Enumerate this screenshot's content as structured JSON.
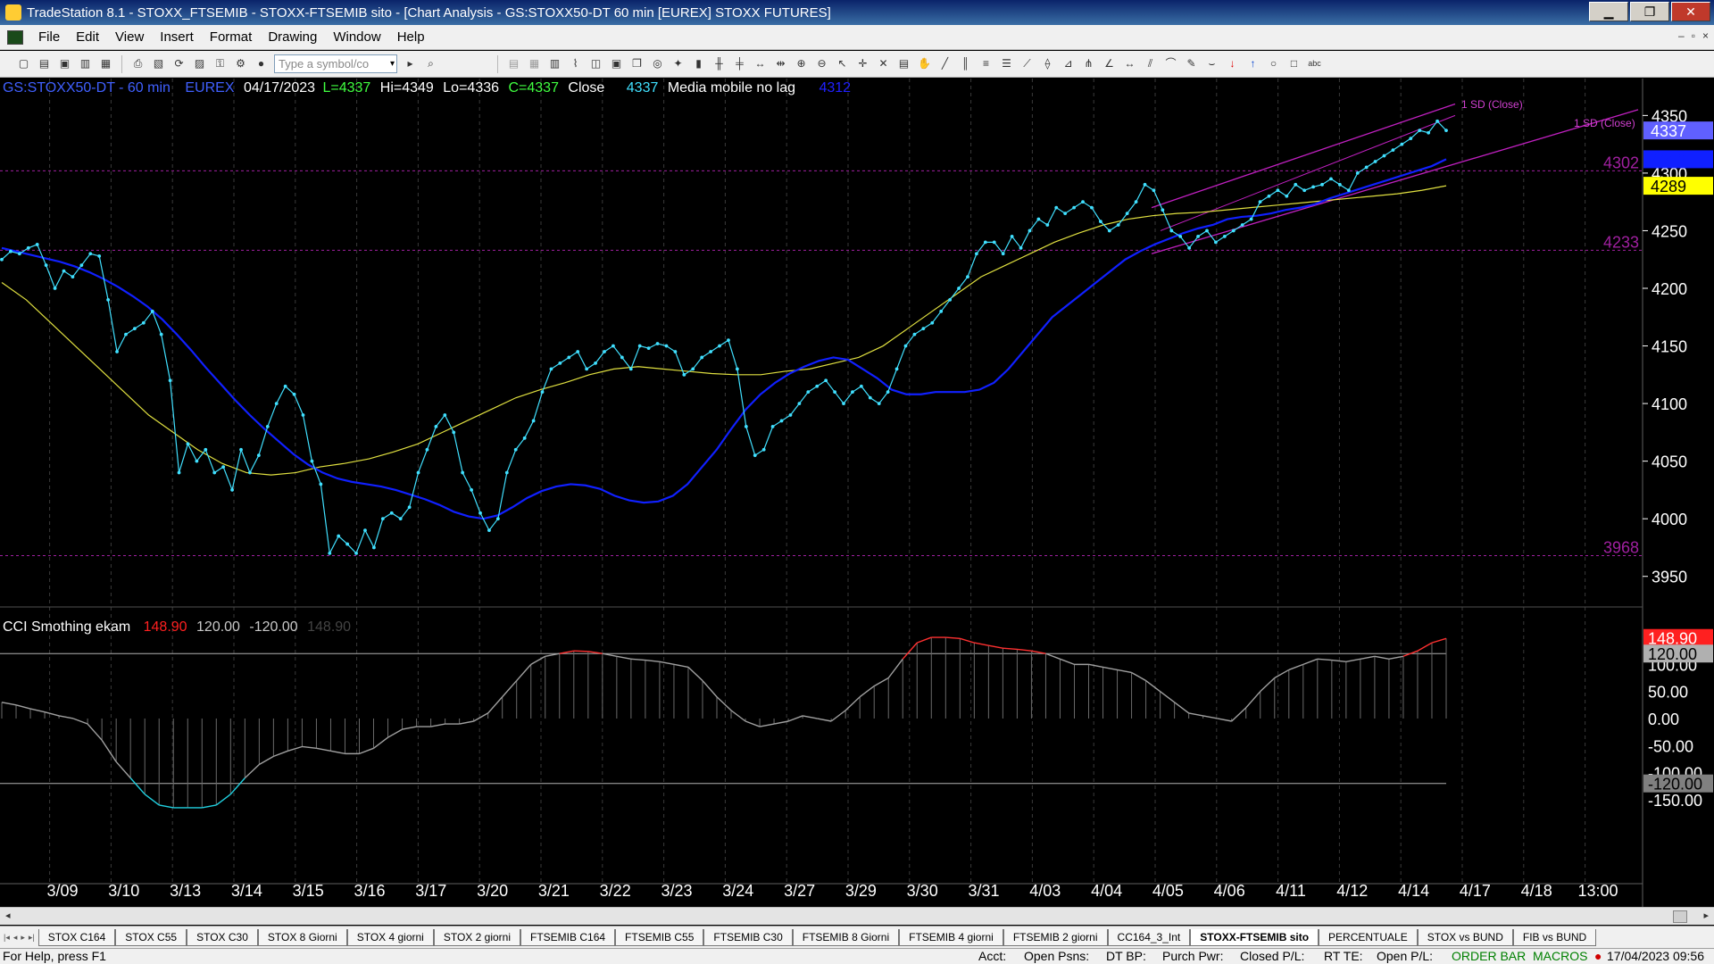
{
  "window": {
    "title": "TradeStation 8.1 - STOXX_FTSEMIB - STOXX-FTSEMIB sito - [Chart Analysis - GS:STOXX50-DT  60 min  [EUREX] STOXX FUTURES]",
    "btn_minimize": "▁",
    "btn_restore": "❐",
    "btn_close": "✕"
  },
  "menu": [
    "File",
    "Edit",
    "View",
    "Insert",
    "Format",
    "Drawing",
    "Window",
    "Help"
  ],
  "mdi_buttons": [
    "–",
    "▫",
    "×"
  ],
  "toolbar": {
    "symbol_placeholder": "Type a symbol/co",
    "dropdown_arrow": "▾"
  },
  "toolbar_icons_left": [
    "new-doc",
    "open",
    "save",
    "print",
    "print-preview",
    "refresh",
    "clipboard",
    "lock",
    "settings",
    "ticker"
  ],
  "toolbar_icons_right": [
    "bars",
    "chart-type",
    "grid",
    "zoom-in",
    "zoom-out",
    "cursor",
    "crosshair",
    "tools",
    "trendline",
    "channel",
    "fib",
    "ellipse",
    "text"
  ],
  "header": {
    "symbol": "GS:STOXX50-DT - 60 min",
    "exchange": "EUREX",
    "date": "04/17/2023",
    "last": "L=4337",
    "high": "Hi=4349",
    "low": "Lo=4336",
    "close": "C=4337",
    "close_label": "Close",
    "close_value": "4337",
    "indicator_name": "Media mobile no lag",
    "indicator_value": "4312",
    "color_symbol": "#4060ff",
    "color_ohlc": "#ffffff",
    "color_close": "#40ff40",
    "color_close_value": "#40e0ff",
    "color_indicator_value": "#2020ff"
  },
  "price_axis": {
    "ticks": [
      "4350",
      "4300",
      "4250",
      "4200",
      "4150",
      "4100",
      "4050",
      "4000",
      "3950"
    ],
    "tag_close": "4337",
    "tag_ma": "4312",
    "tag_ma2": "4289",
    "level_labels": [
      "4302",
      "4233",
      "3968"
    ],
    "channel_label_1": "1 SD (Close)",
    "channel_label_2": "1 SD (Close)"
  },
  "cci_header": {
    "name": "CCI Smothing ekam",
    "value": "148.90",
    "upper": "120.00",
    "lower": "-120.00",
    "ghost": "148.90"
  },
  "cci_axis": {
    "ticks": [
      "100.00",
      "50.00",
      "0.00",
      "-50.00",
      "-100.00",
      "-150.00"
    ],
    "tag_value": "148.90",
    "tag_upper": "120.00",
    "tag_lower": "-120.00"
  },
  "date_axis": [
    "3/09",
    "3/10",
    "3/13",
    "3/14",
    "3/15",
    "3/16",
    "3/17",
    "3/20",
    "3/21",
    "3/22",
    "3/23",
    "3/24",
    "3/27",
    "3/29",
    "3/30",
    "3/31",
    "4/03",
    "4/04",
    "4/05",
    "4/06",
    "4/11",
    "4/12",
    "4/14",
    "4/17",
    "4/18",
    "13:00"
  ],
  "tabs": [
    "STOX C164",
    "STOX C55",
    "STOX  C30",
    "STOX  8 Giorni",
    "STOX 4 giorni",
    "STOX  2 giorni",
    "FTSEMIB C164",
    "FTSEMIB C55",
    "FTSEMIB C30",
    "FTSEMIB  8 Giorni",
    "FTSEMIB  4 giorni",
    "FTSEMIB  2 giorni",
    "CC164_3_Int",
    "STOXX-FTSEMIB sito",
    "PERCENTUALE",
    "STOX vs BUND",
    "FIB vs BUND"
  ],
  "active_tab": "STOXX-FTSEMIB sito",
  "status": {
    "help": "For Help, press F1",
    "acct": "Acct:",
    "open_psns": "Open Psns:",
    "dt_bp": "DT BP:",
    "purch_pwr": "Purch Pwr:",
    "closed_pl": "Closed P/L:",
    "rt_te": "RT TE:",
    "open_pl": "Open P/L:",
    "order_bar": "ORDER BAR",
    "macros": "MACROS",
    "datetime": "17/04/2023 09:56"
  },
  "chart_data": {
    "type": "line",
    "title": "GS:STOXX50-DT - 60 min",
    "xlabel": "",
    "ylabel": "",
    "x": [
      "3/09",
      "3/10",
      "3/13",
      "3/14",
      "3/15",
      "3/16",
      "3/17",
      "3/20",
      "3/21",
      "3/22",
      "3/23",
      "3/24",
      "3/27",
      "3/29",
      "3/30",
      "3/31",
      "4/03",
      "4/04",
      "4/05",
      "4/06",
      "4/11",
      "4/12",
      "4/14",
      "4/17"
    ],
    "ylim": [
      3925,
      4365
    ],
    "series": [
      {
        "values": [
          4225,
          4232,
          4230,
          4235,
          4238,
          4220,
          4200,
          4215,
          4210,
          4220,
          4230,
          4228,
          4190,
          4145,
          4160,
          4165,
          4170,
          4180,
          4160,
          4120,
          4040,
          4065,
          4050,
          4060,
          4040,
          4045,
          4025,
          4060,
          4040,
          4055,
          4080,
          4100,
          4115,
          4108,
          4090,
          4050,
          4030,
          3970,
          3985,
          3978,
          3970,
          3990,
          3975,
          4000,
          4005,
          4000,
          4010,
          4040,
          4060,
          4080,
          4090,
          4075,
          4040,
          4025,
          4005,
          3990,
          4000,
          4040,
          4060,
          4070,
          4085,
          4110,
          4130,
          4135,
          4140,
          4145,
          4130,
          4135,
          4145,
          4150,
          4140,
          4130,
          4150,
          4148,
          4152,
          4150,
          4145,
          4125,
          4130,
          4140,
          4145,
          4150,
          4155,
          4130,
          4080,
          4055,
          4060,
          4080,
          4085,
          4090,
          4100,
          4110,
          4115,
          4120,
          4110,
          4100,
          4110,
          4115,
          4105,
          4100,
          4110,
          4130,
          4150,
          4160,
          4165,
          4170,
          4180,
          4190,
          4200,
          4210,
          4230,
          4240,
          4240,
          4230,
          4245,
          4235,
          4250,
          4260,
          4255,
          4270,
          4265,
          4270,
          4275,
          4270,
          4258,
          4250,
          4255,
          4265,
          4275,
          4290,
          4285,
          4268,
          4250,
          4245,
          4235,
          4245,
          4250,
          4240,
          4245,
          4250,
          4255,
          4260,
          4275,
          4280,
          4285,
          4280,
          4290,
          4285,
          4288,
          4290,
          4295,
          4290,
          4285,
          4300,
          4305,
          4310,
          4315,
          4320,
          4325,
          4330,
          4337,
          4335,
          4345,
          4337
        ]
      },
      {
        "values": [
          4235,
          4232,
          4229,
          4226,
          4223,
          4219,
          4214,
          4208,
          4201,
          4193,
          4184,
          4173,
          4160,
          4146,
          4131,
          4117,
          4103,
          4090,
          4078,
          4067,
          4056,
          4047,
          4040,
          4035,
          4032,
          4030,
          4028,
          4025,
          4021,
          4017,
          4012,
          4006,
          4002,
          4000,
          4003,
          4010,
          4018,
          4024,
          4028,
          4030,
          4029,
          4026,
          4020,
          4016,
          4014,
          4015,
          4020,
          4030,
          4045,
          4060,
          4078,
          4095,
          4108,
          4118,
          4126,
          4132,
          4137,
          4140,
          4138,
          4130,
          4122,
          4112,
          4108,
          4108,
          4110,
          4110,
          4110,
          4112,
          4118,
          4130,
          4145,
          4160,
          4175,
          4185,
          4195,
          4205,
          4215,
          4225,
          4232,
          4238,
          4243,
          4248,
          4252,
          4255,
          4260,
          4262,
          4263,
          4265,
          4268,
          4270,
          4273,
          4278,
          4282,
          4286,
          4290,
          4294,
          4298,
          4302,
          4306,
          4312
        ]
      },
      {
        "values": [
          4205,
          4190,
          4170,
          4150,
          4130,
          4110,
          4090,
          4075,
          4060,
          4048,
          4040,
          4038,
          4040,
          4045,
          4048,
          4052,
          4058,
          4065,
          4075,
          4085,
          4095,
          4105,
          4112,
          4118,
          4125,
          4130,
          4132,
          4130,
          4128,
          4126,
          4125,
          4125,
          4128,
          4130,
          4135,
          4140,
          4150,
          4165,
          4180,
          4195,
          4210,
          4220,
          4230,
          4240,
          4248,
          4255,
          4260,
          4263,
          4265,
          4266,
          4268,
          4270,
          4272,
          4274,
          4276,
          4278,
          4280,
          4282,
          4285,
          4289
        ]
      }
    ],
    "channel": {
      "label": "1 SD (Close)",
      "upper_start": 4270,
      "upper_end": 4360,
      "lower_start": 4230,
      "lower_end": 4310
    },
    "levels": [
      4302,
      4233,
      3968
    ],
    "cci": {
      "name": "CCI Smothing ekam",
      "ylim": [
        -170,
        160
      ],
      "levels": [
        120,
        -120
      ],
      "values": [
        30,
        25,
        18,
        12,
        5,
        0,
        -10,
        -40,
        -80,
        -110,
        -140,
        -160,
        -165,
        -165,
        -165,
        -160,
        -140,
        -110,
        -85,
        -70,
        -60,
        -52,
        -55,
        -60,
        -65,
        -65,
        -55,
        -35,
        -20,
        -15,
        -15,
        -10,
        -10,
        -5,
        10,
        40,
        70,
        100,
        115,
        120,
        125,
        124,
        120,
        115,
        110,
        108,
        105,
        100,
        95,
        70,
        40,
        15,
        -5,
        -15,
        -10,
        -5,
        5,
        0,
        -5,
        15,
        40,
        60,
        75,
        110,
        140,
        150,
        150,
        148,
        140,
        135,
        130,
        128,
        125,
        120,
        110,
        100,
        100,
        95,
        90,
        85,
        70,
        50,
        30,
        10,
        5,
        0,
        -5,
        20,
        50,
        75,
        90,
        100,
        110,
        108,
        105,
        110,
        115,
        110,
        115,
        125,
        140,
        148
      ]
    }
  }
}
